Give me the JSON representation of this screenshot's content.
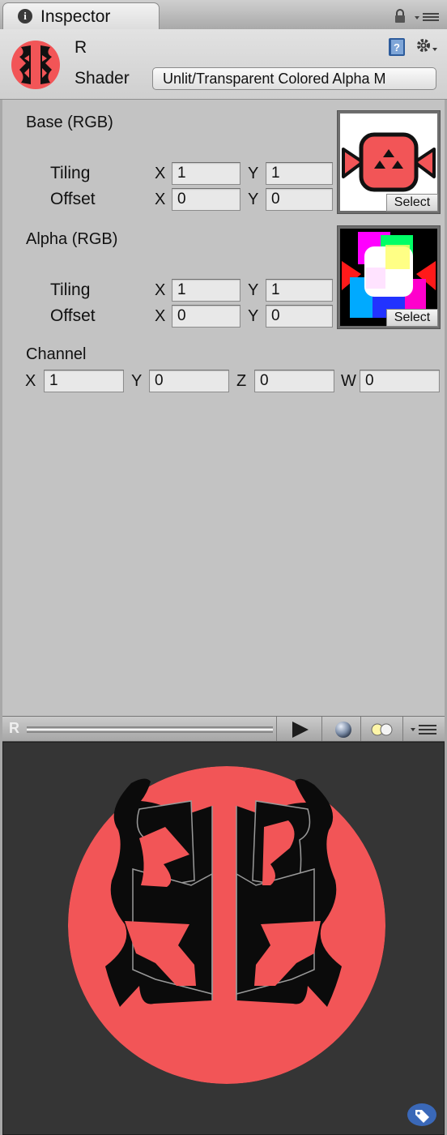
{
  "tab": {
    "title": "Inspector",
    "icon": "info-icon"
  },
  "header": {
    "material_name": "R",
    "shader_label": "Shader",
    "shader_value": "Unlit/Transparent Colored Alpha M",
    "icons": [
      "help-book-icon",
      "gear-icon",
      "lock-icon"
    ]
  },
  "properties": {
    "base": {
      "title": "Base (RGB)",
      "tiling_label": "Tiling",
      "offset_label": "Offset",
      "tiling": {
        "x_label": "X",
        "x": "1",
        "y_label": "Y",
        "y": "1"
      },
      "offset": {
        "x_label": "X",
        "x": "0",
        "y_label": "Y",
        "y": "0"
      },
      "select_label": "Select"
    },
    "alpha": {
      "title": "Alpha (RGB)",
      "tiling_label": "Tiling",
      "offset_label": "Offset",
      "tiling": {
        "x_label": "X",
        "x": "1",
        "y_label": "Y",
        "y": "1"
      },
      "offset": {
        "x_label": "X",
        "x": "0",
        "y_label": "Y",
        "y": "0"
      },
      "select_label": "Select"
    },
    "channel": {
      "title": "Channel",
      "x_label": "X",
      "x": "1",
      "y_label": "Y",
      "y": "0",
      "z_label": "Z",
      "z": "0",
      "w_label": "W",
      "w": "0"
    }
  },
  "preview": {
    "name": "R",
    "icons": [
      "play-icon",
      "sphere-icon",
      "lights-icon",
      "menu-icon",
      "label-tag-icon"
    ]
  },
  "colors": {
    "accent_red": "#f25557",
    "panel_bg": "#c3c3c3",
    "preview_bg": "#353535"
  }
}
